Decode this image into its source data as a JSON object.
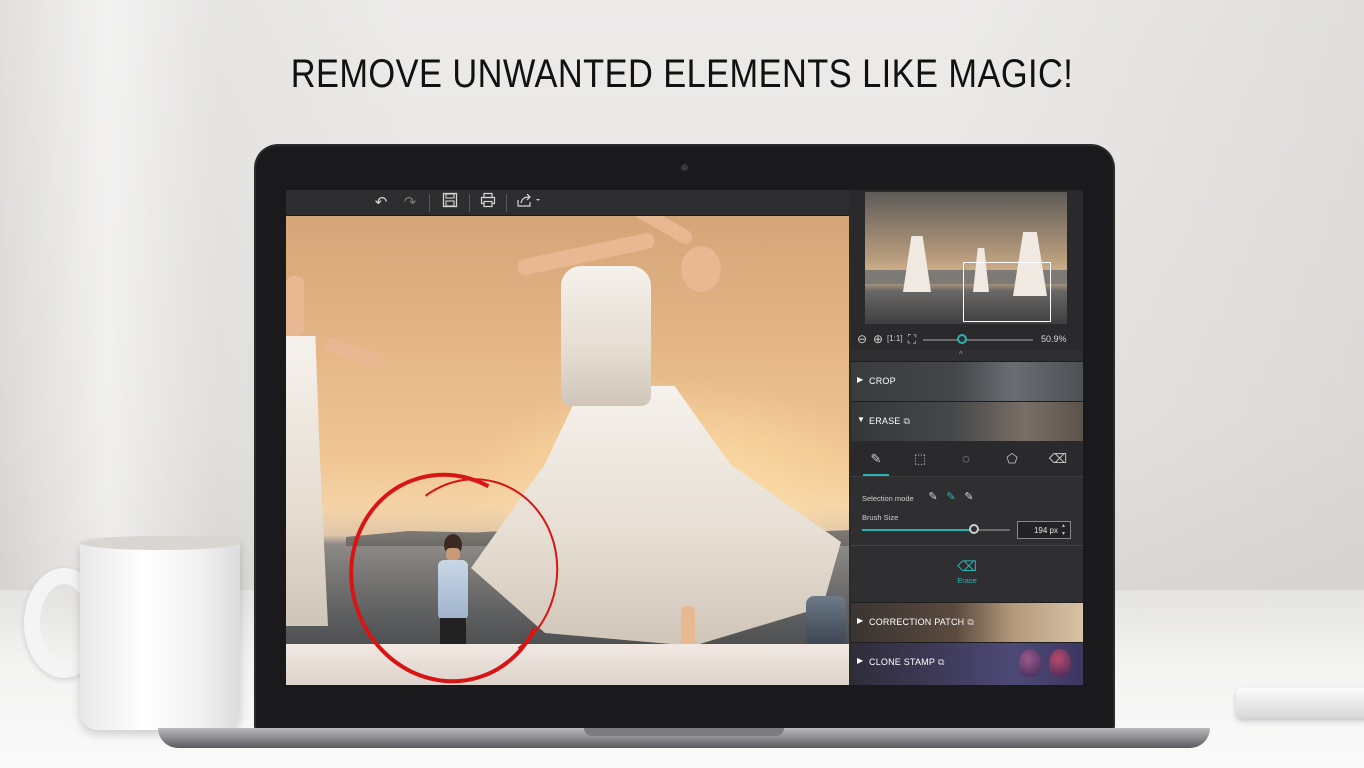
{
  "headline": "REMOVE UNWANTED ELEMENTS LIKE MAGIC!",
  "toolbar": {
    "undo_icon": "undo-icon",
    "redo_icon": "redo-icon",
    "save_icon": "save-icon",
    "print_icon": "print-icon",
    "share_icon": "share-icon"
  },
  "navigator": {
    "zoom_value": "50.9%",
    "icons": [
      "zoom-out-icon",
      "zoom-in-icon",
      "actual-size-icon",
      "fit-screen-icon"
    ]
  },
  "sections": {
    "crop": "CROP",
    "erase": "ERASE",
    "correction_patch": "CORRECTION PATCH",
    "clone_stamp": "CLONE STAMP"
  },
  "erase_tools": [
    "brush-tool-icon",
    "rect-select-icon",
    "lasso-icon",
    "polygon-lasso-icon",
    "eraser-icon"
  ],
  "options": {
    "selection_mode_label": "Selection mode",
    "brush_size_label": "Brush Size",
    "brush_size_value": "194 px",
    "brush_size_fraction": 0.76
  },
  "erase_button": {
    "label": "Erase"
  },
  "colors": {
    "accent": "#2ab3b3",
    "annotation_ring": "#d81414",
    "panel_bg": "#2f2f31"
  }
}
